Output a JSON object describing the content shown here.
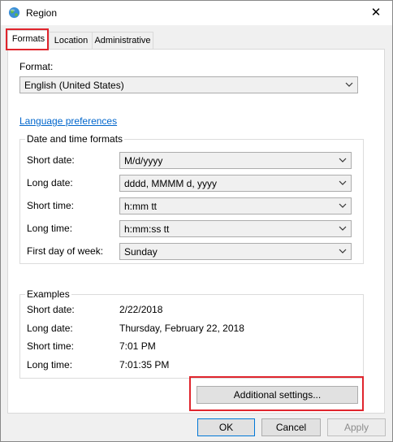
{
  "window": {
    "title": "Region",
    "close_glyph": "✕"
  },
  "tabs": [
    {
      "label": "Formats",
      "active": true
    },
    {
      "label": "Location",
      "active": false
    },
    {
      "label": "Administrative",
      "active": false
    }
  ],
  "format": {
    "label": "Format:",
    "value": "English (United States)"
  },
  "language_link": "Language preferences",
  "datetime": {
    "title": "Date and time formats",
    "rows": [
      {
        "label": "Short date:",
        "value": "M/d/yyyy"
      },
      {
        "label": "Long date:",
        "value": "dddd, MMMM d, yyyy"
      },
      {
        "label": "Short time:",
        "value": "h:mm tt"
      },
      {
        "label": "Long time:",
        "value": "h:mm:ss tt"
      },
      {
        "label": "First day of week:",
        "value": "Sunday"
      }
    ]
  },
  "examples": {
    "title": "Examples",
    "rows": [
      {
        "label": "Short date:",
        "value": "2/22/2018"
      },
      {
        "label": "Long date:",
        "value": "Thursday, February 22, 2018"
      },
      {
        "label": "Short time:",
        "value": "7:01 PM"
      },
      {
        "label": "Long time:",
        "value": "7:01:35 PM"
      }
    ]
  },
  "buttons": {
    "additional": "Additional settings...",
    "ok": "OK",
    "cancel": "Cancel",
    "apply": "Apply"
  },
  "highlight_color": "#e0252d",
  "link_color": "#0066cc"
}
